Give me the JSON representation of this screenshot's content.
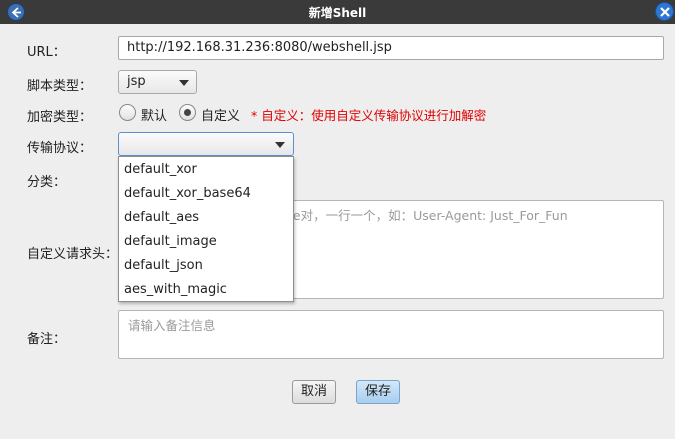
{
  "window": {
    "title": "新增Shell",
    "app_icon": "back-arrow-icon",
    "close_icon": "close-icon"
  },
  "form": {
    "url": {
      "label": "URL：",
      "value": "http://192.168.31.236:8080/webshell.jsp"
    },
    "script_type": {
      "label": "脚本类型：",
      "selected": "jsp"
    },
    "encryption_type": {
      "label": "加密类型：",
      "options": [
        "默认",
        "自定义"
      ],
      "selected": "自定义",
      "hint": "* 自定义：使用自定义传输协议进行加解密",
      "hint_color": "#e00000"
    },
    "protocol": {
      "label": "传输协议：",
      "selected": "",
      "dropdown_items": [
        "default_xor",
        "default_xor_base64",
        "default_aes",
        "default_image",
        "default_json",
        "aes_with_magic"
      ]
    },
    "category": {
      "label": "分类："
    },
    "custom_headers": {
      "label": "自定义请求头：",
      "placeholder": "ue对，一行一个，如：User-Agent: Just_For_Fun"
    },
    "remark": {
      "label": "备注：",
      "placeholder": "请输入备注信息"
    }
  },
  "buttons": {
    "cancel": "取消",
    "save": "保存"
  },
  "colors": {
    "titlebar": "#3a3a3a",
    "close_button": "#2f76d2",
    "save_button": "#a8cdee"
  }
}
